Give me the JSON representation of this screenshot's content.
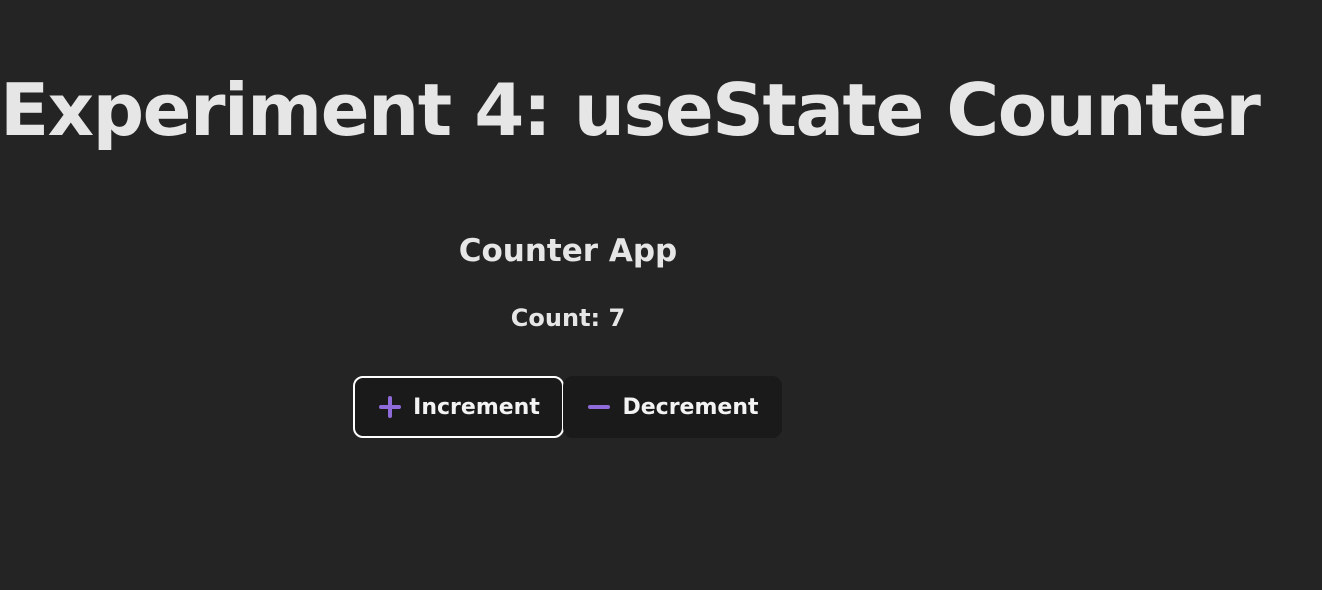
{
  "page": {
    "title": "Experiment 4: useState Counter"
  },
  "counter": {
    "title": "Counter App",
    "count_label": "Count: 7",
    "increment_label": "Increment",
    "decrement_label": "Decrement",
    "increment_icon": "plus-icon",
    "decrement_icon": "minus-icon"
  },
  "colors": {
    "background": "#242424",
    "button_background": "#1a1a1a",
    "accent_icon": "#8e6bd8",
    "focus_border": "#ffffff"
  }
}
